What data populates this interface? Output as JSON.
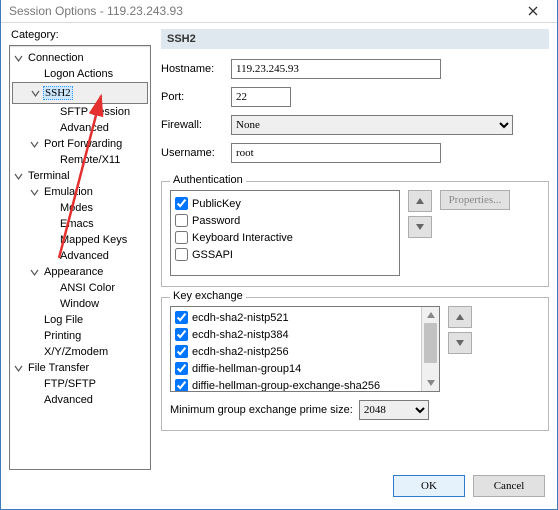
{
  "window": {
    "title": "Session Options - 119.23.243.93"
  },
  "category_label": "Category:",
  "tree": [
    {
      "label": "Connection",
      "indent": 0,
      "tick": "down",
      "sel": false
    },
    {
      "label": "Logon Actions",
      "indent": 1,
      "tick": "",
      "sel": false
    },
    {
      "label": "SSH2",
      "indent": 1,
      "tick": "down",
      "sel": true
    },
    {
      "label": "SFTP Session",
      "indent": 2,
      "tick": "",
      "sel": false
    },
    {
      "label": "Advanced",
      "indent": 2,
      "tick": "",
      "sel": false
    },
    {
      "label": "Port Forwarding",
      "indent": 1,
      "tick": "down",
      "sel": false
    },
    {
      "label": "Remote/X11",
      "indent": 2,
      "tick": "",
      "sel": false
    },
    {
      "label": "Terminal",
      "indent": 0,
      "tick": "down",
      "sel": false
    },
    {
      "label": "Emulation",
      "indent": 1,
      "tick": "down",
      "sel": false
    },
    {
      "label": "Modes",
      "indent": 2,
      "tick": "",
      "sel": false
    },
    {
      "label": "Emacs",
      "indent": 2,
      "tick": "",
      "sel": false
    },
    {
      "label": "Mapped Keys",
      "indent": 2,
      "tick": "",
      "sel": false
    },
    {
      "label": "Advanced",
      "indent": 2,
      "tick": "",
      "sel": false
    },
    {
      "label": "Appearance",
      "indent": 1,
      "tick": "down",
      "sel": false
    },
    {
      "label": "ANSI Color",
      "indent": 2,
      "tick": "",
      "sel": false
    },
    {
      "label": "Window",
      "indent": 2,
      "tick": "",
      "sel": false
    },
    {
      "label": "Log File",
      "indent": 1,
      "tick": "",
      "sel": false
    },
    {
      "label": "Printing",
      "indent": 1,
      "tick": "",
      "sel": false
    },
    {
      "label": "X/Y/Zmodem",
      "indent": 1,
      "tick": "",
      "sel": false
    },
    {
      "label": "File Transfer",
      "indent": 0,
      "tick": "down",
      "sel": false
    },
    {
      "label": "FTP/SFTP",
      "indent": 1,
      "tick": "",
      "sel": false
    },
    {
      "label": "Advanced",
      "indent": 1,
      "tick": "",
      "sel": false
    }
  ],
  "panel": {
    "header": "SSH2",
    "hostname_label": "Hostname:",
    "hostname_value": "119.23.245.93",
    "port_label": "Port:",
    "port_value": "22",
    "firewall_label": "Firewall:",
    "firewall_value": "None",
    "username_label": "Username:",
    "username_value": "root",
    "auth": {
      "title": "Authentication",
      "items": [
        {
          "label": "PublicKey",
          "checked": true
        },
        {
          "label": "Password",
          "checked": false
        },
        {
          "label": "Keyboard Interactive",
          "checked": false
        },
        {
          "label": "GSSAPI",
          "checked": false
        }
      ],
      "properties": "Properties..."
    },
    "kex": {
      "title": "Key exchange",
      "items": [
        {
          "label": "ecdh-sha2-nistp521",
          "checked": true
        },
        {
          "label": "ecdh-sha2-nistp384",
          "checked": true
        },
        {
          "label": "ecdh-sha2-nistp256",
          "checked": true
        },
        {
          "label": "diffie-hellman-group14",
          "checked": true
        },
        {
          "label": "diffie-hellman-group-exchange-sha256",
          "checked": true
        }
      ],
      "min_label": "Minimum group exchange prime size:",
      "min_value": "2048"
    }
  },
  "buttons": {
    "ok": "OK",
    "cancel": "Cancel"
  }
}
